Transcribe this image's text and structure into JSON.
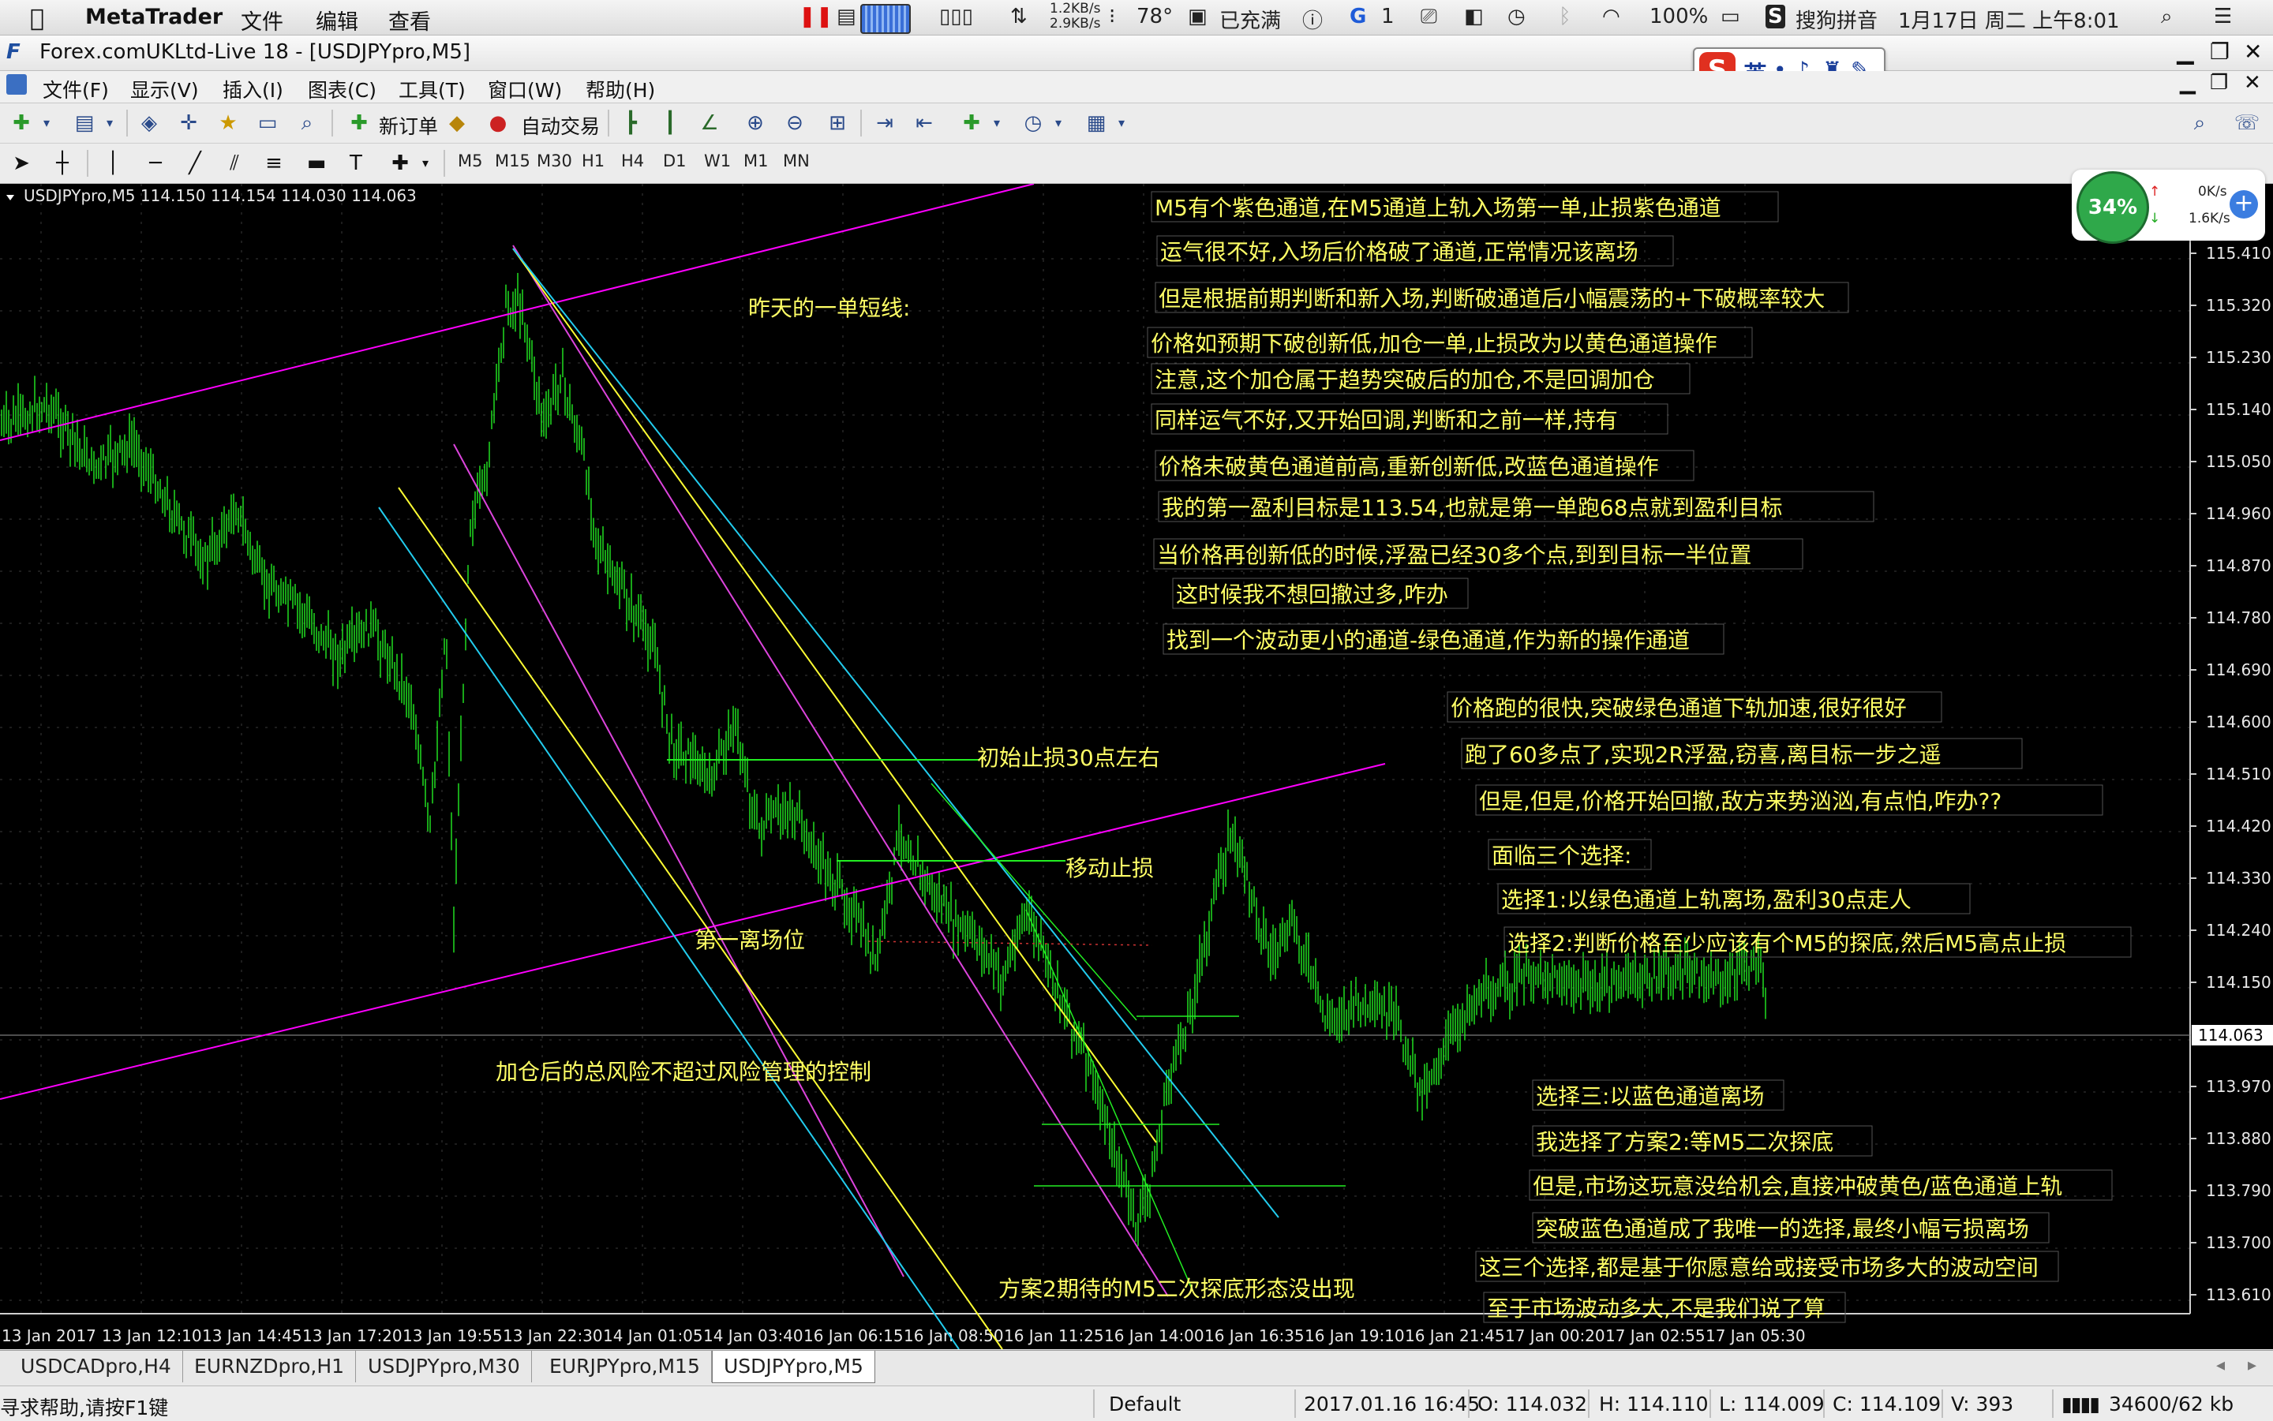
{
  "macos": {
    "apple": "",
    "app_name": "MetaTrader",
    "menus": [
      "文件",
      "编辑",
      "查看"
    ],
    "net_up": "1.2KB/s",
    "net_down": "2.9KB/s",
    "temperature": "78°",
    "charging": "已充满",
    "notif_count": "1",
    "battery": "100%",
    "ime": "搜狗拼音",
    "datetime": "1月17日 周二 上午8:01"
  },
  "window": {
    "title": "Forex.comUKLtd-Live 18 - [USDJPYpro,M5]"
  },
  "ime_bar": {
    "label": "英"
  },
  "menu": [
    "文件(F)",
    "显示(V)",
    "插入(I)",
    "图表(C)",
    "工具(T)",
    "窗口(W)",
    "帮助(H)"
  ],
  "toolbar": {
    "new_order": "新订单",
    "auto_trade": "自动交易",
    "timeframes": [
      "M5",
      "M15",
      "M30",
      "H1",
      "H4",
      "D1",
      "W1",
      "M1",
      "MN"
    ]
  },
  "gauge": {
    "cpu": "34%",
    "up": "0K/s",
    "down": "1.6K/s"
  },
  "chart": {
    "info": "USDJPYpro,M5  114.150 114.154 114.030 114.063",
    "current_price": "114.063",
    "price_labels": [
      "115.410",
      "115.320",
      "115.230",
      "115.140",
      "115.050",
      "114.960",
      "114.870",
      "114.780",
      "114.690",
      "114.600",
      "114.510",
      "114.420",
      "114.330",
      "114.240",
      "114.150",
      "113.970",
      "113.880",
      "113.790",
      "113.700",
      "113.610"
    ],
    "time_labels": [
      "13 Jan 2017",
      "13 Jan 12:10",
      "13 Jan 14:45",
      "13 Jan 17:20",
      "13 Jan 19:55",
      "13 Jan 22:30",
      "14 Jan 01:05",
      "14 Jan 03:40",
      "16 Jan 06:15",
      "16 Jan 08:50",
      "16 Jan 11:25",
      "16 Jan 14:00",
      "16 Jan 16:35",
      "16 Jan 19:10",
      "16 Jan 21:45",
      "17 Jan 00:20",
      "17 Jan 02:55",
      "17 Jan 05:30"
    ],
    "annotations": [
      "M5有个紫色通道,在M5通道上轨入场第一单,止损紫色通道",
      "运气很不好,入场后价格破了通道,正常情况该离场",
      "但是根据前期判断和新入场,判断破通道后小幅震荡的+下破概率较大",
      "价格如预期下破创新低,加仓一单,止损改为以黄色通道操作",
      "注意,这个加仓属于趋势突破后的加仓,不是回调加仓",
      "同样运气不好,又开始回调,判断和之前一样,持有",
      "价格未破黄色通道前高,重新创新低,改蓝色通道操作",
      "我的第一盈利目标是113.54,也就是第一单跑68点就到盈利目标",
      "当价格再创新低的时候,浮盈已经30多个点,到到目标一半位置",
      "这时候我不想回撤过多,咋办",
      "找到一个波动更小的通道-绿色通道,作为新的操作通道",
      "价格跑的很快,突破绿色通道下轨加速,很好很好",
      "跑了60多点了,实现2R浮盈,窃喜,离目标一步之遥",
      "但是,但是,价格开始回撤,敌方来势汹汹,有点怕,咋办??",
      "面临三个选择:",
      "选择1:以绿色通道上轨离场,盈利30点走人",
      "选择2:判断价格至少应该有个M5的探底,然后M5高点止损",
      "选择三:以蓝色通道离场",
      "我选择了方案2:等M5二次探底",
      "但是,市场这玩意没给机会,直接冲破黄色/蓝色通道上轨",
      "突破蓝色通道成了我唯一的选择,最终小幅亏损离场",
      "这三个选择,都是基于你愿意给或接受市场多大的波动空间",
      "至于市场波动多大,不是我们说了算"
    ],
    "side_notes": {
      "yesterday": "昨天的一单短线:",
      "initial_stop": "初始止损30点左右",
      "moving_stop": "移动止损",
      "first_exit": "第一离场位",
      "risk_note": "加仓后的总风险不超过风险管理的控制",
      "plan2": "方案2期待的M5二次探底形态没出现"
    }
  },
  "tabs": [
    "USDCADpro,H4",
    "EURNZDpro,H1",
    "USDJPYpro,M30",
    "EURJPYpro,M15",
    "USDJPYpro,M5"
  ],
  "status": {
    "help": "寻求帮助,请按F1键",
    "profile": "Default",
    "datetime": "2017.01.16 16:45",
    "open": "O: 114.032",
    "high": "H: 114.110",
    "low": "L: 114.009",
    "close": "C: 114.109",
    "volume": "V: 393",
    "traffic": "34600/62 kb"
  },
  "colors": {
    "magenta": "#ff00ff",
    "violet": "#dd44dd",
    "yellow": "#ffff33",
    "cyan": "#22ccee",
    "green": "#22ee22",
    "annotation_text": "#ffff66"
  }
}
